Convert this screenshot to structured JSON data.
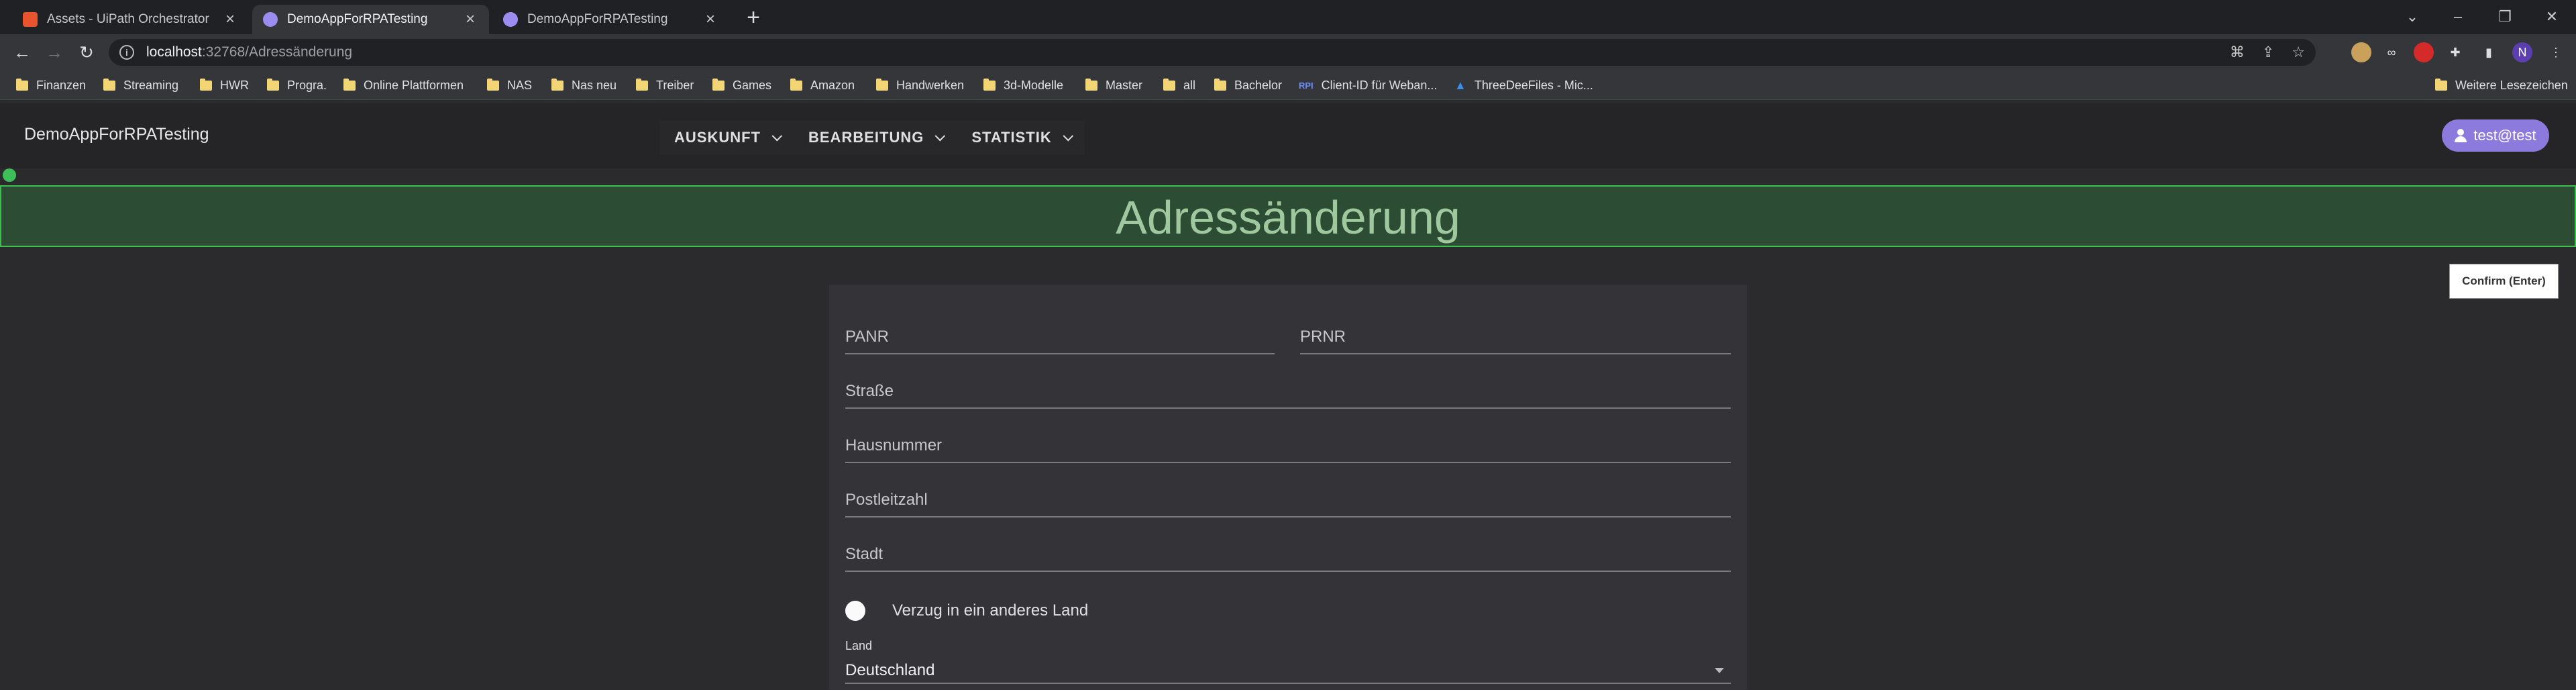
{
  "browser": {
    "tabs": [
      {
        "title": "Assets - UiPath Orchestrator",
        "active": false
      },
      {
        "title": "DemoAppForRPATesting",
        "active": true
      },
      {
        "title": "DemoAppForRPATesting",
        "active": false
      }
    ],
    "new_tab": "+",
    "url_host": "localhost",
    "url_path": ":32768/Adressänderung",
    "bookmarks": [
      "Finanzen",
      "Streaming",
      "HWR",
      "Progra.",
      "Online Plattformen",
      "NAS",
      "Nas neu",
      "Treiber",
      "Games",
      "Amazon",
      "Handwerken",
      "3d-Modelle",
      "Master",
      "all",
      "Bachelor",
      "Client-ID für Weban...",
      "ThreeDeeFiles - Mic..."
    ],
    "other_bookmarks": "Weitere Lesezeichen",
    "profile_initial": "N"
  },
  "app": {
    "brand": "DemoAppForRPATesting",
    "menu": [
      "AUSKUNFT",
      "BEARBEITUNG",
      "STATISTIK"
    ],
    "user": "test@test"
  },
  "page": {
    "title": "Adressänderung",
    "confirm_label": "Confirm (Enter)"
  },
  "form": {
    "panr": "PANR",
    "prnr": "PRNR",
    "strasse": "Straße",
    "hausnummer": "Hausnummer",
    "plz": "Postleitzahl",
    "stadt": "Stadt",
    "toggle_label": "Verzug in ein anderes Land",
    "land_label": "Land",
    "land_value": "Deutschland"
  },
  "colors": {
    "accent": "#8c7bdc",
    "banner_bg": "#2c4d33",
    "banner_border": "#3bc04e"
  }
}
